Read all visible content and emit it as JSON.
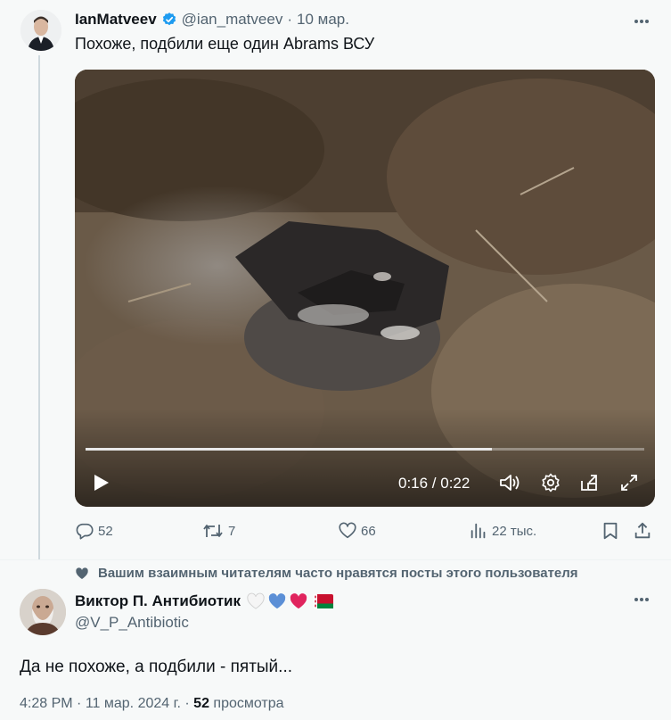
{
  "tweet": {
    "author_name": "IanMatveev",
    "author_handle": "@ian_matveev",
    "separator": "·",
    "date": "10 мар.",
    "text": "Похоже, подбили еще один Abrams ВСУ",
    "video": {
      "time": "0:16 / 0:22",
      "progress": 0.727
    },
    "actions": {
      "replies": "52",
      "reposts": "7",
      "likes": "66",
      "views": "22 тыс."
    }
  },
  "social_context": "Вашим взаимным читателям часто нравятся посты этого пользователя",
  "reply": {
    "author_name": "Виктор П. Антибиотик",
    "author_handle": "@V_P_Antibiotic",
    "text": "Да не похоже, а подбили - пятый...",
    "time": "4:28 PM",
    "separator": "·",
    "date": "11 мар. 2024 г.",
    "separator2": "·",
    "views_count": "52",
    "views_label": "просмотра"
  },
  "colors": {
    "verified": "#1d9bf0",
    "secondary_text": "#536471",
    "heart_red": "#e0245e",
    "heart_blue": "#5b8fd6"
  }
}
